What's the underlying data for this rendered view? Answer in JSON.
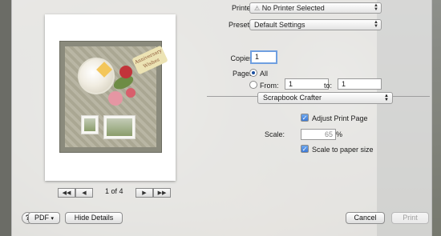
{
  "printer": {
    "label": "Printer:",
    "value": "No Printer Selected",
    "icon": "warning-icon"
  },
  "presets": {
    "label": "Presets:",
    "value": "Default Settings"
  },
  "copies": {
    "label": "Copies:",
    "value": "1"
  },
  "pages": {
    "label": "Pages:",
    "all_label": "All",
    "from_label": "From:",
    "from_value": "1",
    "to_label": "to:",
    "to_value": "1"
  },
  "section": {
    "value": "Scrapbook Crafter"
  },
  "adjust_print_page": {
    "label": "Adjust Print Page",
    "checked": true
  },
  "scale": {
    "label": "Scale:",
    "value": "65",
    "unit": "%"
  },
  "scale_to_paper": {
    "label": "Scale to paper size",
    "checked": true
  },
  "preview": {
    "page_indicator": "1 of 4",
    "tag_text": "Anniversary Wishes"
  },
  "buttons": {
    "help": "?",
    "pdf": "PDF",
    "hide_details": "Hide Details",
    "cancel": "Cancel",
    "print": "Print"
  }
}
